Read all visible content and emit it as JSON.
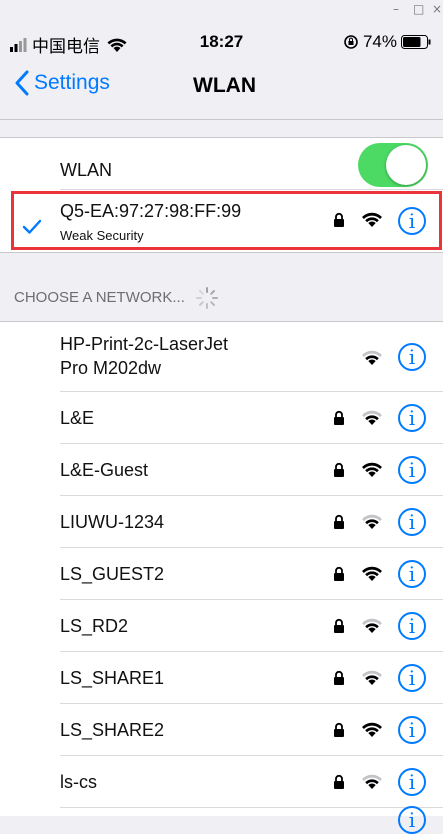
{
  "window_controls": {
    "minimize": "–",
    "maximize": "□",
    "close": "×"
  },
  "status_bar": {
    "carrier": "中国电信",
    "time": "18:27",
    "battery": "74%"
  },
  "nav": {
    "back_label": "Settings",
    "title": "WLAN"
  },
  "wlan_toggle": {
    "label": "WLAN",
    "on": true
  },
  "connected": {
    "ssid": "Q5-EA:97:27:98:FF:99",
    "subtitle": "Weak Security"
  },
  "section_header": "CHOOSE A NETWORK...",
  "networks": [
    {
      "name": "HP-Print-2c-LaserJet",
      "name2": "Pro M202dw",
      "locked": false,
      "signal": "medium"
    },
    {
      "name": "L&E",
      "locked": true,
      "signal": "medium"
    },
    {
      "name": "L&E-Guest",
      "locked": true,
      "signal": "strong"
    },
    {
      "name": "LIUWU-1234",
      "locked": true,
      "signal": "medium"
    },
    {
      "name": "LS_GUEST2",
      "locked": true,
      "signal": "strong"
    },
    {
      "name": "LS_RD2",
      "locked": true,
      "signal": "medium"
    },
    {
      "name": "LS_SHARE1",
      "locked": true,
      "signal": "medium"
    },
    {
      "name": "LS_SHARE2",
      "locked": true,
      "signal": "strong"
    },
    {
      "name": "ls-cs",
      "locked": true,
      "signal": "medium"
    }
  ],
  "colors": {
    "accent": "#007aff",
    "toggle_on": "#4cd964",
    "highlight": "#e8343a"
  }
}
